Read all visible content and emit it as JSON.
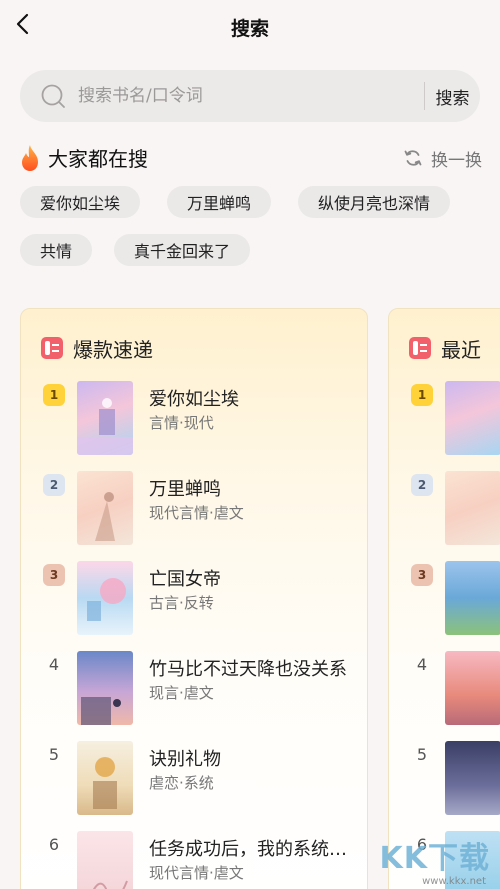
{
  "header": {
    "title": "搜索"
  },
  "search": {
    "placeholder": "搜索书名/口令词",
    "value": "",
    "button_label": "搜索"
  },
  "hot": {
    "title": "大家都在搜",
    "refresh_label": "换一换",
    "tags": [
      "爱你如尘埃",
      "万里蝉鸣",
      "纵使月亮也深情",
      "共情",
      "真千金回来了"
    ]
  },
  "rankings": [
    {
      "title": "爆款速递",
      "items": [
        {
          "rank": "1",
          "title": "爱你如尘埃",
          "meta": "言情·现代"
        },
        {
          "rank": "2",
          "title": "万里蝉鸣",
          "meta": "现代言情·虐文"
        },
        {
          "rank": "3",
          "title": "亡国女帝",
          "meta": "古言·反转"
        },
        {
          "rank": "4",
          "title": "竹马比不过天降也没关系",
          "meta": "现言·虐文"
        },
        {
          "rank": "5",
          "title": "诀别礼物",
          "meta": "虐恋·系统"
        },
        {
          "rank": "6",
          "title": "任务成功后，我的系统却...",
          "meta": "现代言情·虐文"
        }
      ]
    },
    {
      "title": "最近",
      "items": [
        {
          "rank": "1"
        },
        {
          "rank": "2"
        },
        {
          "rank": "3"
        },
        {
          "rank": "4"
        },
        {
          "rank": "5"
        },
        {
          "rank": "6"
        }
      ]
    }
  ],
  "watermark": {
    "logo": "KK下载",
    "url": "www.kkx.net"
  }
}
